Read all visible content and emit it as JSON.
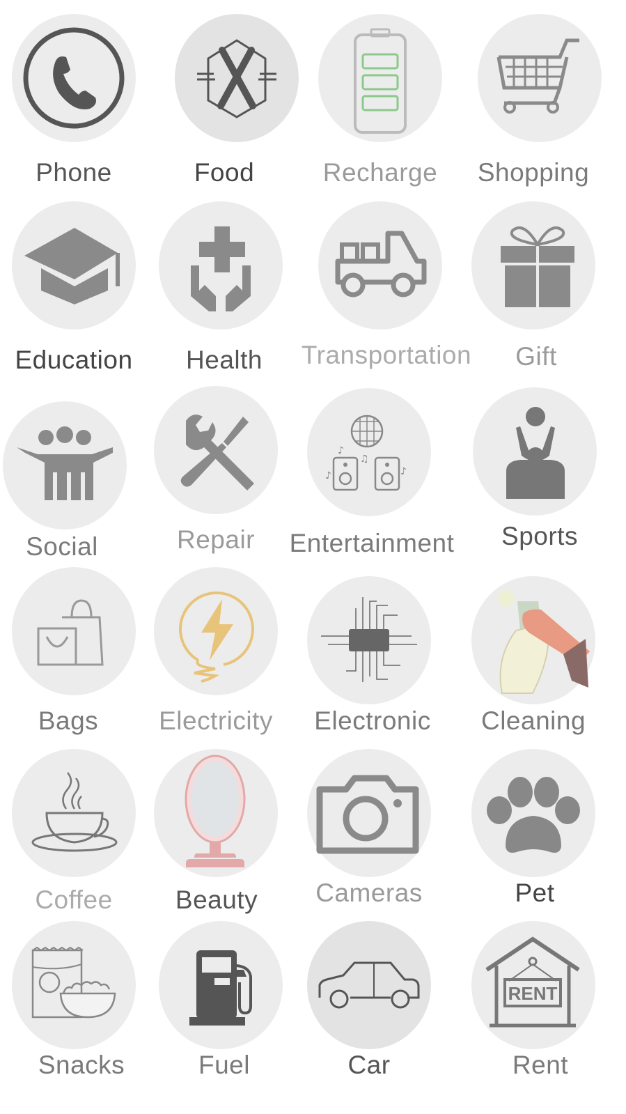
{
  "categories": [
    {
      "label": "Phone",
      "icon": "phone-icon"
    },
    {
      "label": "Food",
      "icon": "fork-cross-icon"
    },
    {
      "label": "Recharge",
      "icon": "battery-icon"
    },
    {
      "label": "Shopping",
      "icon": "shopping-cart-icon"
    },
    {
      "label": "Education",
      "icon": "graduation-cap-icon"
    },
    {
      "label": "Health",
      "icon": "hands-cross-icon"
    },
    {
      "label": "Transportation",
      "icon": "truck-icon"
    },
    {
      "label": "Gift",
      "icon": "gift-icon"
    },
    {
      "label": "Social",
      "icon": "people-group-icon"
    },
    {
      "label": "Repair",
      "icon": "wrench-screwdriver-icon"
    },
    {
      "label": "Entertainment",
      "icon": "disco-speakers-icon"
    },
    {
      "label": "Sports",
      "icon": "volleyball-player-icon"
    },
    {
      "label": "Bags",
      "icon": "shopping-bags-icon"
    },
    {
      "label": "Electricity",
      "icon": "lightning-plug-icon"
    },
    {
      "label": "Electronic",
      "icon": "microchip-icon"
    },
    {
      "label": "Cleaning",
      "icon": "spray-bottle-icon"
    },
    {
      "label": "Coffee",
      "icon": "coffee-cup-icon"
    },
    {
      "label": "Beauty",
      "icon": "vanity-mirror-icon"
    },
    {
      "label": "Cameras",
      "icon": "camera-icon"
    },
    {
      "label": "Pet",
      "icon": "paw-icon"
    },
    {
      "label": "Snacks",
      "icon": "snacks-bowl-icon"
    },
    {
      "label": "Fuel",
      "icon": "fuel-pump-icon"
    },
    {
      "label": "Car",
      "icon": "car-icon"
    },
    {
      "label": "Rent",
      "icon": "rent-sign-icon"
    }
  ],
  "rent_sign_text": "RENT",
  "colors": {
    "circle": "#ececec",
    "icon_gray": "#8a8a8a",
    "icon_dark": "#555555",
    "battery_green": "#8cc98c",
    "lightning_yellow": "#e8c47a",
    "mirror_pink": "#e3a8a8"
  }
}
